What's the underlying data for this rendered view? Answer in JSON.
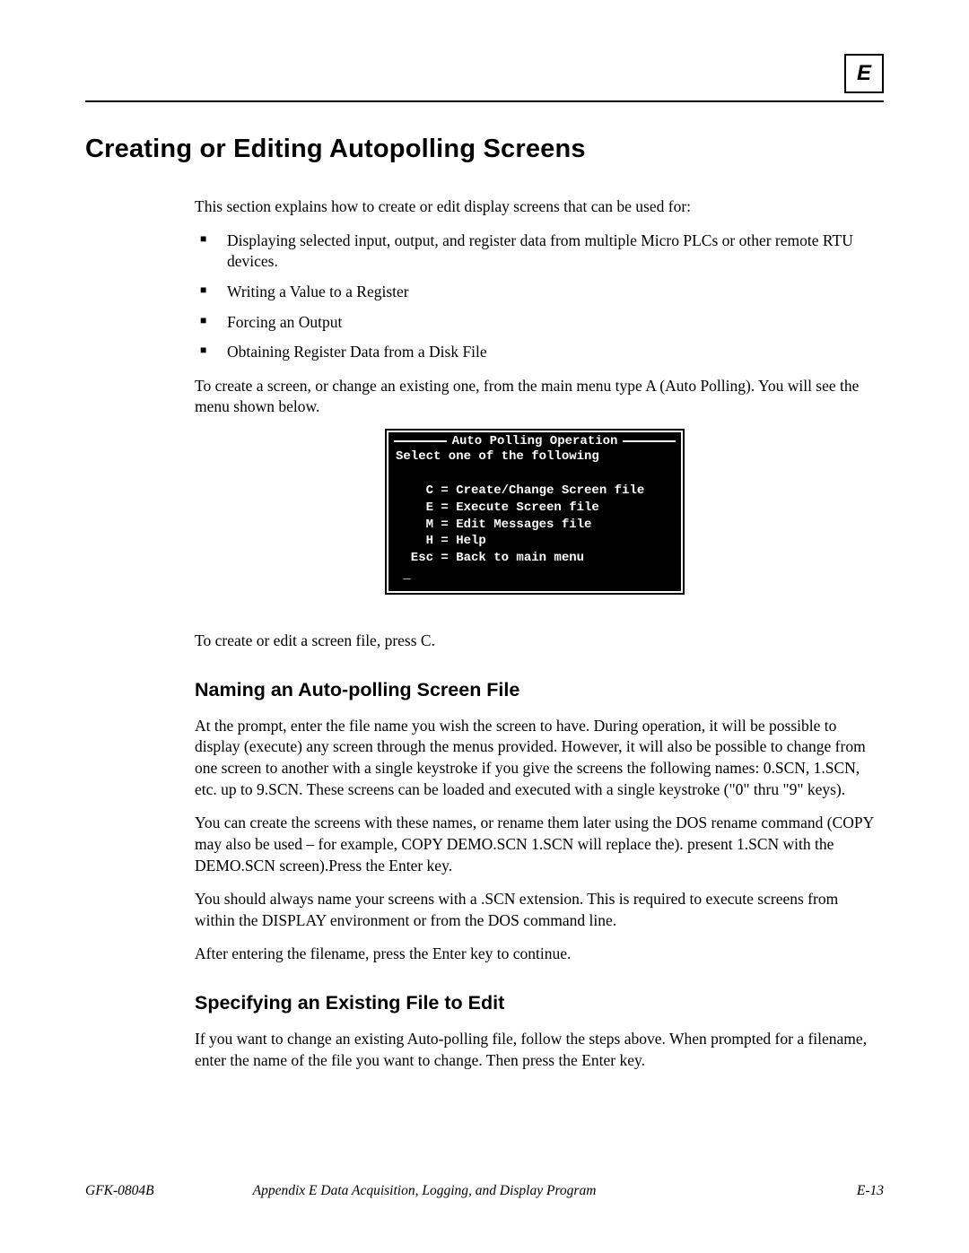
{
  "header": {
    "section_letter": "E"
  },
  "title": "Creating or Editing Autopolling Screens",
  "intro": "This section explains how to create or edit display screens that can be used for:",
  "bullets": [
    "Displaying selected input, output, and register data from multiple Micro PLCs or other remote RTU devices.",
    "Writing a Value to a Register",
    "Forcing an Output",
    "Obtaining Register Data from a Disk File"
  ],
  "after_bullets": "To create a screen, or change an existing one, from the main menu type A (Auto Polling). You will see the menu shown below.",
  "terminal": {
    "title": "Auto Polling Operation",
    "lines": "Select one of the following\n\n    C = Create/Change Screen file\n    E = Execute Screen file\n    M = Edit Messages file\n    H = Help\n  Esc = Back to main menu\n _"
  },
  "after_terminal": "To create or edit a screen file, press C.",
  "sections": [
    {
      "heading": "Naming an Auto-polling Screen File",
      "paragraphs": [
        "At the prompt, enter the file name you wish the screen to have.  During operation, it will be possible to display (execute) any screen through the menus provided. However, it will also be possible to change from one screen to another with a single keystroke if you give the screens the following names:  0.SCN, 1.SCN, etc. up to 9.SCN. These screens can be loaded and executed with a single keystroke (\"0\" thru \"9\" keys).",
        "You can create the screens with these names, or rename them later using the DOS rename command (COPY may also be used – for example, COPY DEMO.SCN 1.SCN will replace the). present 1.SCN with the DEMO.SCN screen).Press the Enter key.",
        "You should always name your screens with a .SCN extension. This is required to execute screens from within the DISPLAY environment or from the DOS command line.",
        "After entering the filename, press the Enter key to continue."
      ]
    },
    {
      "heading": "Specifying an Existing File to Edit",
      "paragraphs": [
        "If you want to change an existing Auto-polling file, follow the steps above. When prompted for a filename, enter the name of the file you want to change. Then press the Enter key."
      ]
    }
  ],
  "footer": {
    "doc_id": "GFK-0804B",
    "appendix": "Appendix E Data Acquisition, Logging, and Display Program",
    "page": "E-13"
  }
}
